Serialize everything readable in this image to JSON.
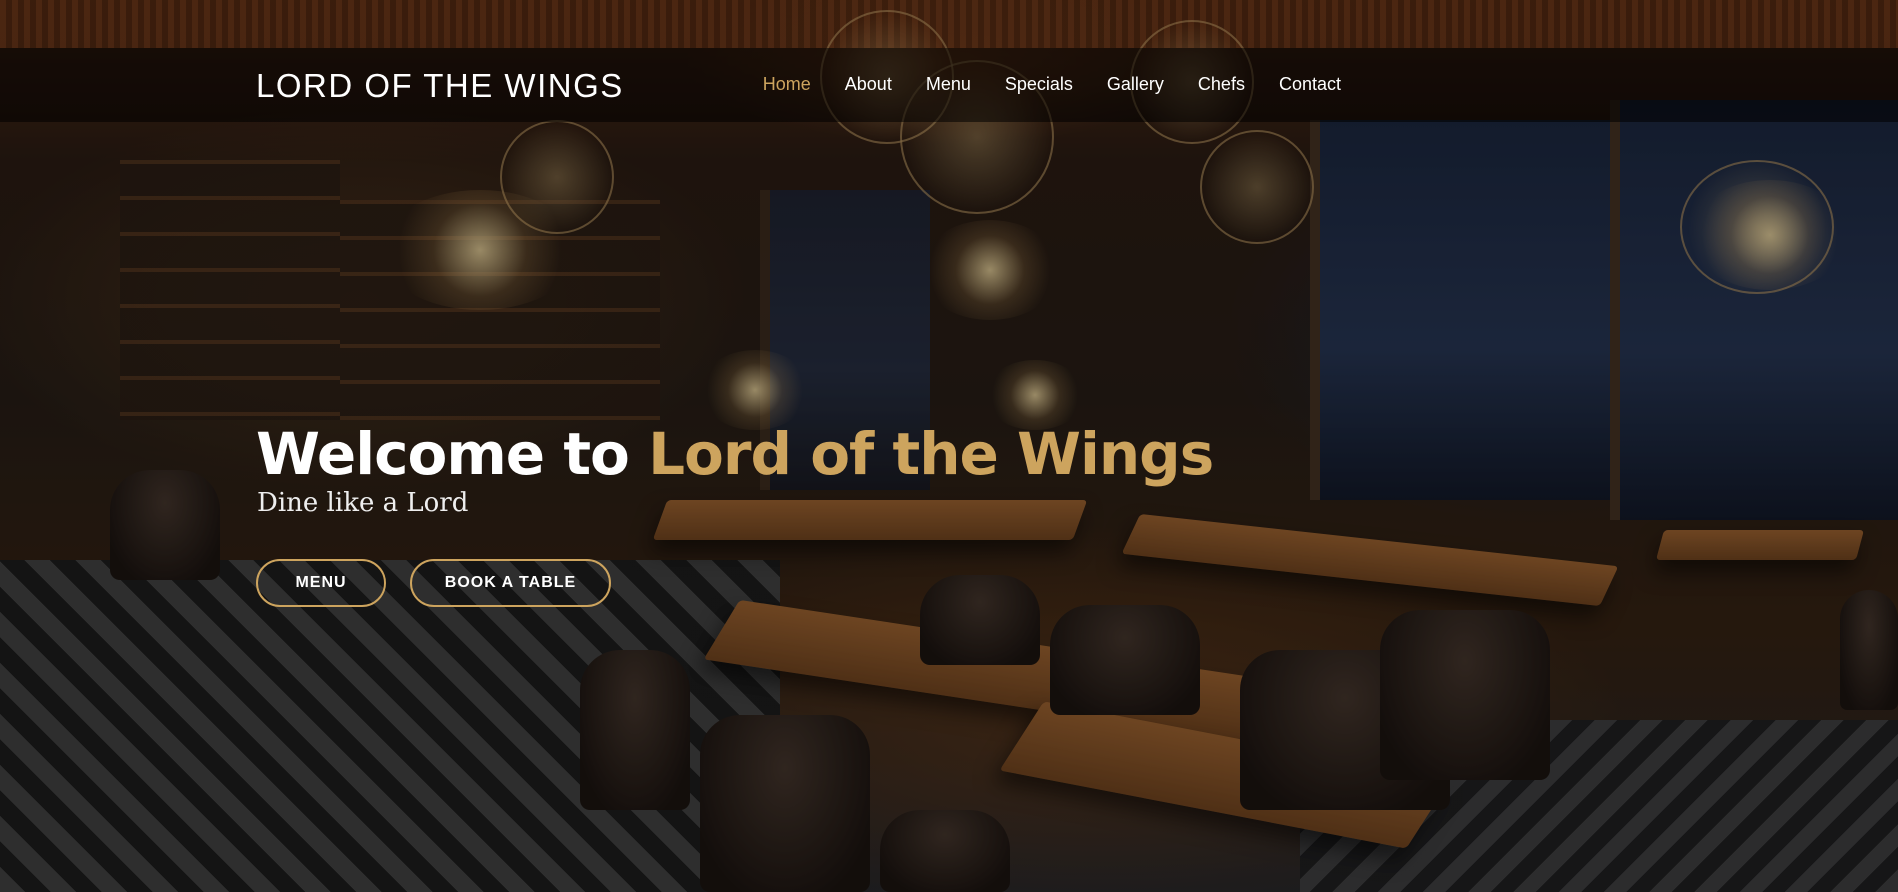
{
  "header": {
    "logo": "LORD OF THE WINGS",
    "nav": [
      {
        "label": "Home",
        "active": true
      },
      {
        "label": "About",
        "active": false
      },
      {
        "label": "Menu",
        "active": false
      },
      {
        "label": "Specials",
        "active": false
      },
      {
        "label": "Gallery",
        "active": false
      },
      {
        "label": "Chefs",
        "active": false
      },
      {
        "label": "Contact",
        "active": false
      }
    ]
  },
  "hero": {
    "headline_prefix": "Welcome to",
    "headline_accent": "Lord of the Wings",
    "subheadline": "Dine like a Lord",
    "buttons": {
      "menu": "MENU",
      "book": "BOOK A TABLE"
    }
  },
  "colors": {
    "accent": "#cda45e",
    "navbar_bg": "rgba(0,0,0,0.55)",
    "text": "#ffffff"
  }
}
